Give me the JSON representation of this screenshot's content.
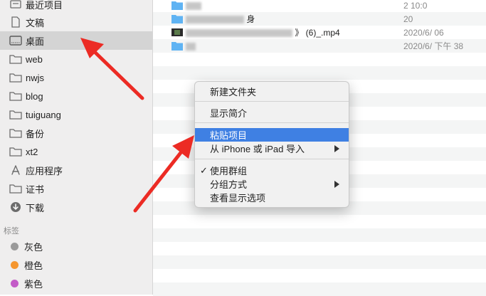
{
  "sidebar": {
    "items": [
      {
        "label": "最近项目",
        "icon": "recents-icon"
      },
      {
        "label": "文稿",
        "icon": "document-icon"
      },
      {
        "label": "桌面",
        "icon": "desktop-icon",
        "selected": true
      },
      {
        "label": "web",
        "icon": "folder-icon"
      },
      {
        "label": "nwjs",
        "icon": "folder-icon"
      },
      {
        "label": "blog",
        "icon": "folder-icon"
      },
      {
        "label": "tuiguang",
        "icon": "folder-icon"
      },
      {
        "label": "备份",
        "icon": "folder-icon"
      },
      {
        "label": "xt2",
        "icon": "folder-icon"
      },
      {
        "label": "应用程序",
        "icon": "applications-icon"
      },
      {
        "label": "证书",
        "icon": "folder-icon"
      },
      {
        "label": "下载",
        "icon": "download-icon"
      }
    ],
    "tags_title": "标签",
    "tags": [
      {
        "label": "灰色",
        "color": "#9a9a9a"
      },
      {
        "label": "橙色",
        "color": "#f5962e"
      },
      {
        "label": "紫色",
        "color": "#c35cc7"
      }
    ]
  },
  "files": [
    {
      "name_visible": "",
      "date_visible": "2  10:0",
      "icon": "folder-icon"
    },
    {
      "name_visible": "身",
      "date_visible": "20",
      "icon": "folder-icon"
    },
    {
      "name_visible": "》 (6)_.mp4",
      "date_visible": "2020/6/  06",
      "icon": "video-file-icon"
    },
    {
      "name_visible": "",
      "date_visible": "2020/6/  下午  38",
      "icon": "folder-icon"
    }
  ],
  "context_menu": {
    "items": [
      {
        "label": "新建文件夹"
      },
      {
        "label": "显示简介"
      },
      {
        "label": "粘贴项目",
        "highlighted": true
      },
      {
        "label": "从 iPhone 或 iPad 导入",
        "submenu": true
      },
      {
        "label": "使用群组",
        "checked": true
      },
      {
        "label": "分组方式",
        "submenu": true
      },
      {
        "label": "查看显示选项"
      }
    ],
    "check_glyph": "✓",
    "highlight_color": "#3f80e3"
  },
  "annotation_color": "#ec2b24"
}
